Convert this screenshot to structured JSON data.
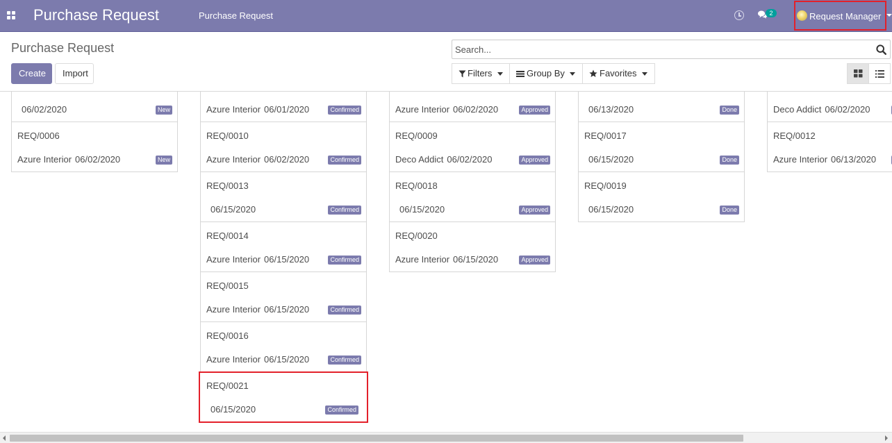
{
  "navbar": {
    "brand": "Purchase Request",
    "menu": "Purchase Request",
    "chat_count": "2",
    "user": "Request Manager"
  },
  "control_panel": {
    "title": "Purchase Request",
    "create_label": "Create",
    "import_label": "Import",
    "search_placeholder": "Search...",
    "filters_label": "Filters",
    "group_by_label": "Group By",
    "favorites_label": "Favorites"
  },
  "kanban": {
    "columns": [
      {
        "cards": [
          {
            "ref": "",
            "partner": "",
            "date": "06/02/2020",
            "status": "New"
          },
          {
            "ref": "REQ/0006",
            "partner": "Azure Interior",
            "date": "06/02/2020",
            "status": "New"
          }
        ]
      },
      {
        "cards": [
          {
            "ref": "",
            "partner": "Azure Interior",
            "date": "06/01/2020",
            "status": "Confirmed"
          },
          {
            "ref": "REQ/0010",
            "partner": "Azure Interior",
            "date": "06/02/2020",
            "status": "Confirmed"
          },
          {
            "ref": "REQ/0013",
            "partner": "",
            "date": "06/15/2020",
            "status": "Confirmed"
          },
          {
            "ref": "REQ/0014",
            "partner": "Azure Interior",
            "date": "06/15/2020",
            "status": "Confirmed"
          },
          {
            "ref": "REQ/0015",
            "partner": "Azure Interior",
            "date": "06/15/2020",
            "status": "Confirmed"
          },
          {
            "ref": "REQ/0016",
            "partner": "Azure Interior",
            "date": "06/15/2020",
            "status": "Confirmed"
          },
          {
            "ref": "REQ/0021",
            "partner": "",
            "date": "06/15/2020",
            "status": "Confirmed"
          }
        ]
      },
      {
        "cards": [
          {
            "ref": "",
            "partner": "Azure Interior",
            "date": "06/02/2020",
            "status": "Approved"
          },
          {
            "ref": "REQ/0009",
            "partner": "Deco Addict",
            "date": "06/02/2020",
            "status": "Approved"
          },
          {
            "ref": "REQ/0018",
            "partner": "",
            "date": "06/15/2020",
            "status": "Approved"
          },
          {
            "ref": "REQ/0020",
            "partner": "Azure Interior",
            "date": "06/15/2020",
            "status": "Approved"
          }
        ]
      },
      {
        "cards": [
          {
            "ref": "",
            "partner": "",
            "date": "06/13/2020",
            "status": "Done"
          },
          {
            "ref": "REQ/0017",
            "partner": "",
            "date": "06/15/2020",
            "status": "Done"
          },
          {
            "ref": "REQ/0019",
            "partner": "",
            "date": "06/15/2020",
            "status": "Done"
          }
        ]
      },
      {
        "cards": [
          {
            "ref": "",
            "partner": "Deco Addict",
            "date": "06/02/2020",
            "status": ""
          },
          {
            "ref": "REQ/0012",
            "partner": "Azure Interior",
            "date": "06/13/2020",
            "status": ""
          }
        ]
      }
    ]
  },
  "colors": {
    "brand": "#7c7bad",
    "highlight": "#e3202a",
    "chat_badge": "#00a09d"
  }
}
